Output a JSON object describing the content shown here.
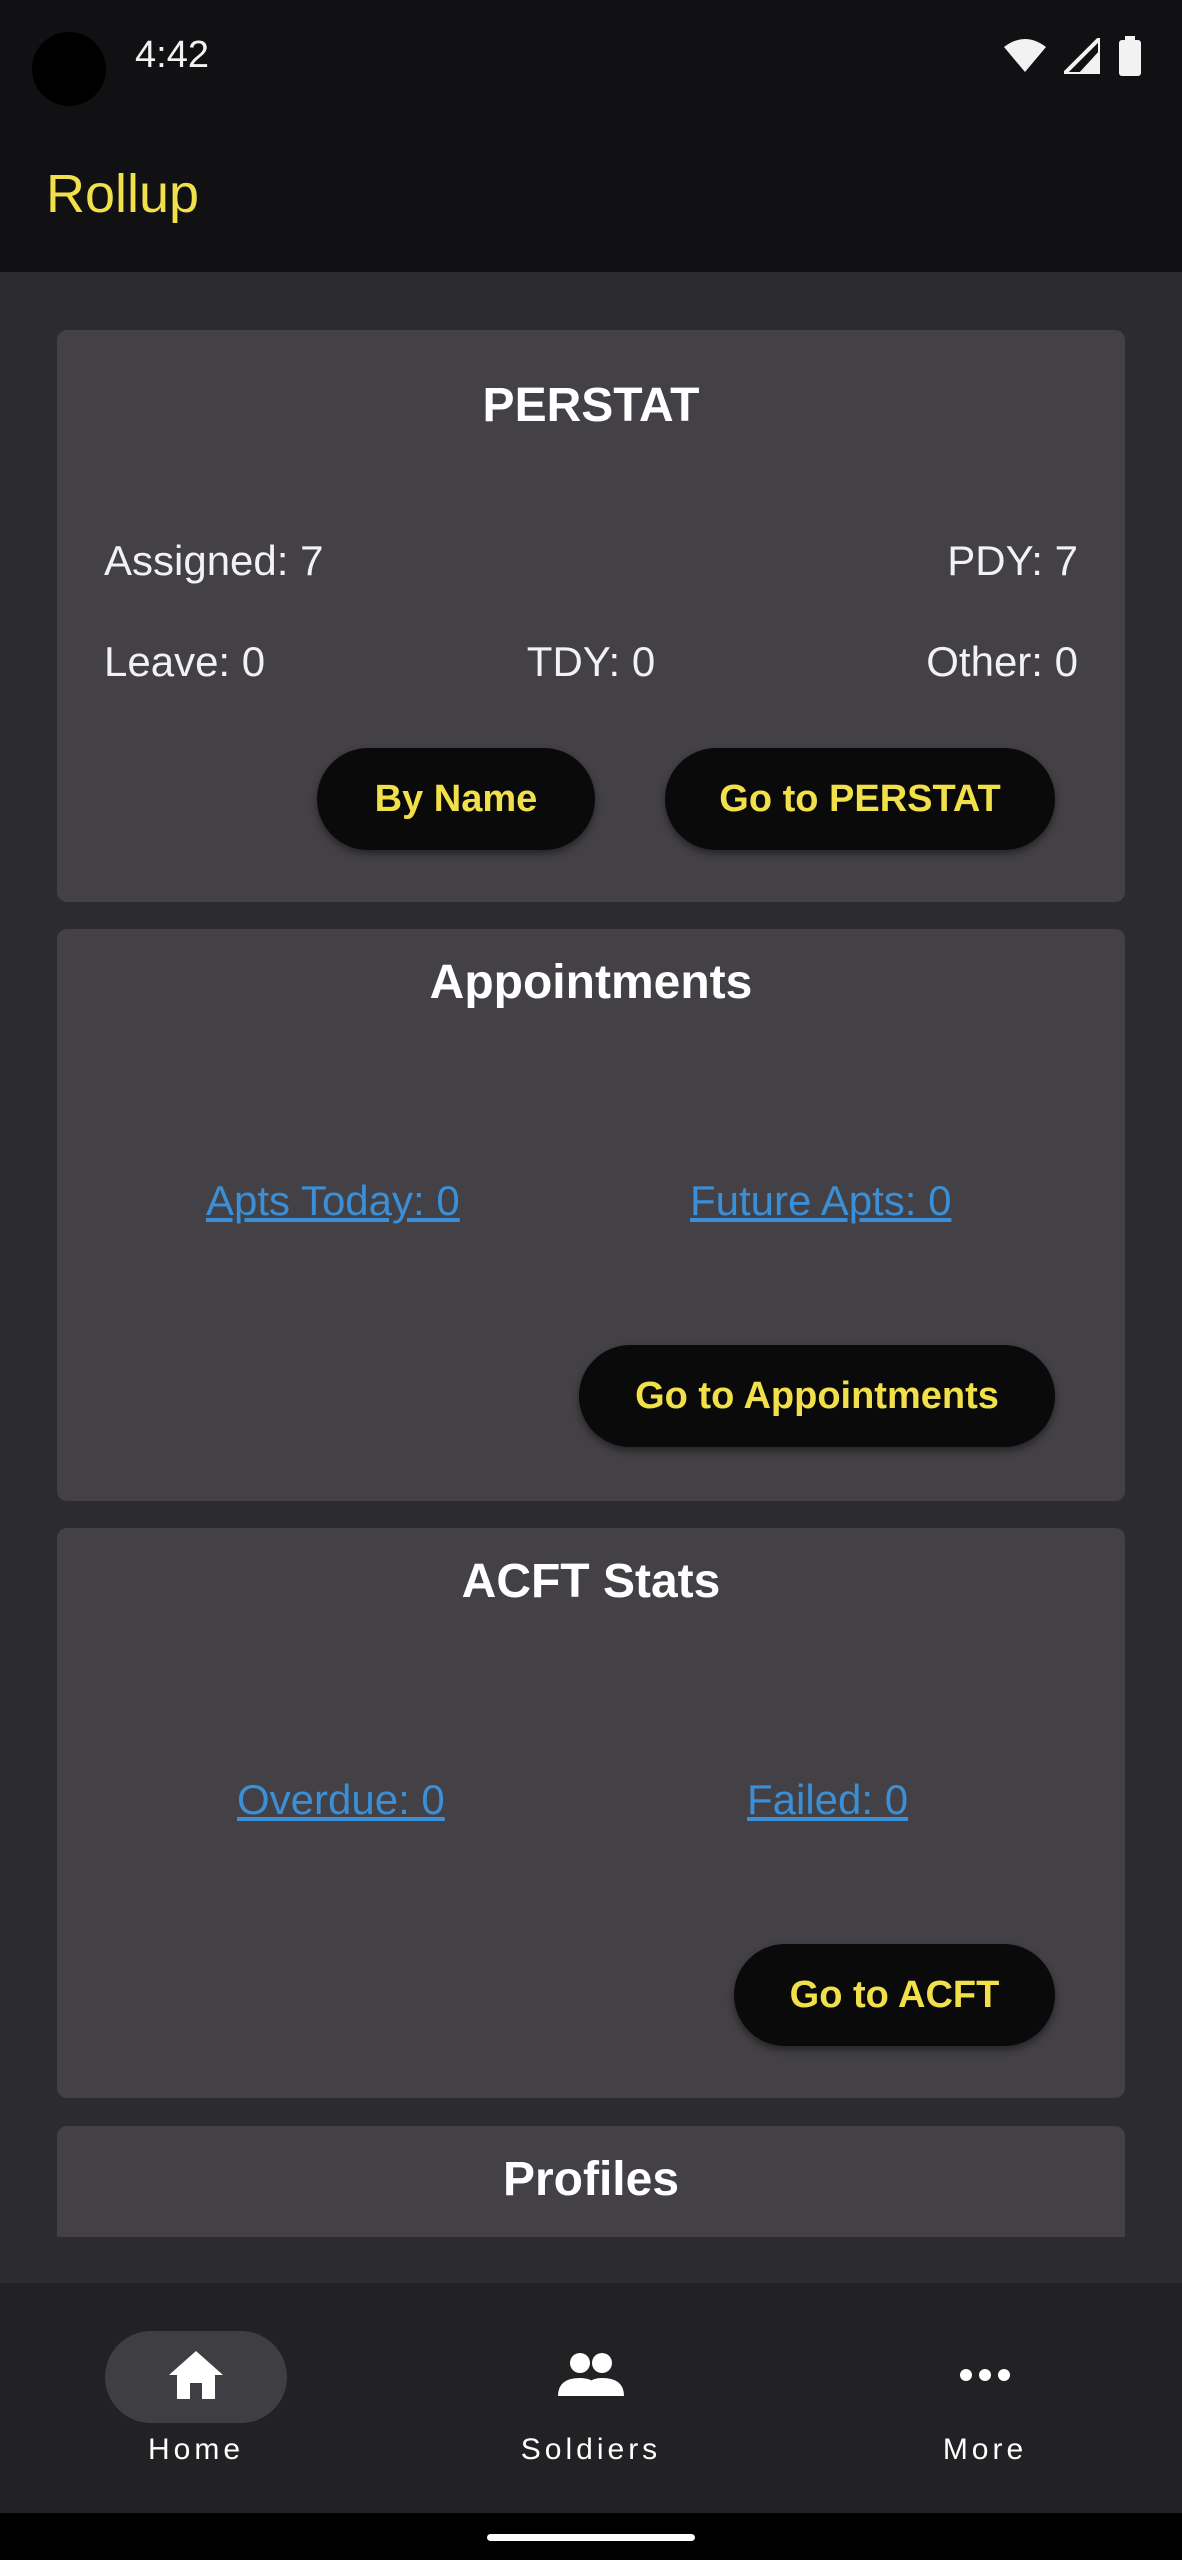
{
  "status_bar": {
    "time": "4:42"
  },
  "app_bar": {
    "title": "Rollup"
  },
  "perstat": {
    "title": "PERSTAT",
    "assigned": "Assigned: 7",
    "pdy": "PDY: 7",
    "leave": "Leave: 0",
    "tdy": "TDY: 0",
    "other": "Other: 0",
    "by_name_label": "By Name",
    "go_label": "Go to PERSTAT"
  },
  "appointments": {
    "title": "Appointments",
    "today_link": "Apts Today: 0",
    "future_link": "Future Apts: 0",
    "go_label": "Go to Appointments"
  },
  "acft": {
    "title": "ACFT Stats",
    "overdue_link": "Overdue: 0",
    "failed_link": "Failed: 0",
    "go_label": "Go to ACFT"
  },
  "profiles": {
    "title": "Profiles"
  },
  "bottom_nav": {
    "items": [
      {
        "label": "Home",
        "icon": "home-icon",
        "active": true
      },
      {
        "label": "Soldiers",
        "icon": "people-icon",
        "active": false
      },
      {
        "label": "More",
        "icon": "more-horiz-icon",
        "active": false
      }
    ]
  },
  "colors": {
    "accent": "#f1e04a",
    "link": "#3a8fd6",
    "card": "#434145",
    "background": "#2c2b2e",
    "bar": "#111113"
  }
}
